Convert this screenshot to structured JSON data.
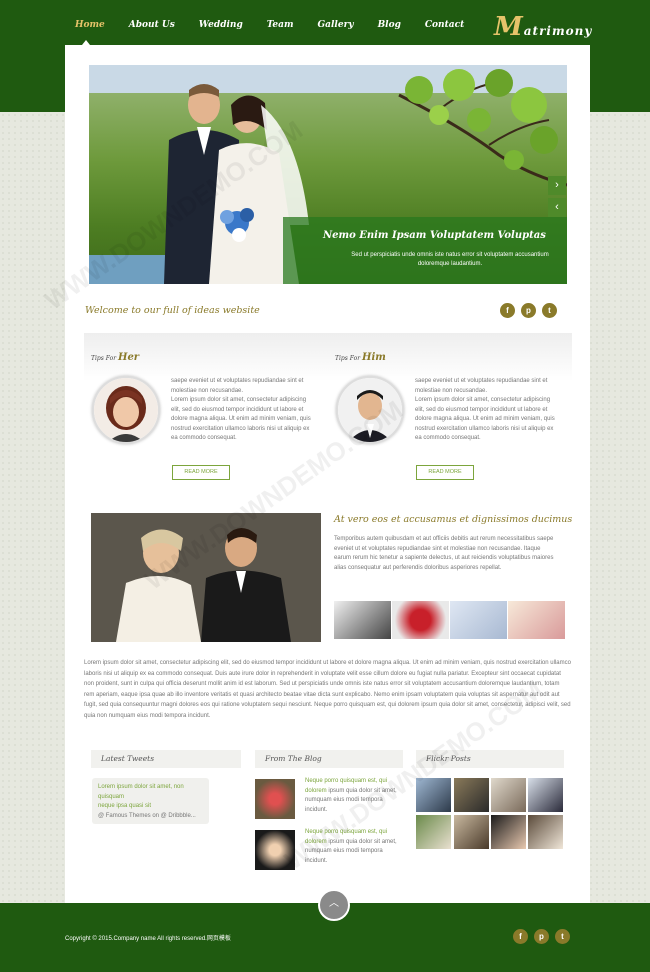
{
  "nav": {
    "items": [
      "Home",
      "About Us",
      "Wedding",
      "Team",
      "Gallery",
      "Blog",
      "Contact"
    ],
    "active": "Home"
  },
  "logo": {
    "first_letter": "M",
    "rest": "atrimony"
  },
  "slider": {
    "caption_title": "Nemo Enim Ipsam Voluptatem Voluptas",
    "caption_text": "Sed ut perspiciatis unde omnis iste natus error sit voluptatem accusantium doloremque laudantium.",
    "next_label": "›",
    "prev_label": "‹"
  },
  "welcome": {
    "text": "Welcome to our full of ideas website"
  },
  "social": {
    "facebook": "f",
    "pinterest": "p",
    "twitter": "t"
  },
  "tips": {
    "her": {
      "prefix": "Tips For",
      "name": "Her",
      "highlight": "saepe eveniet ut et voluptates repudiandae sint et molestiae non recusandae.",
      "body": "Lorem ipsum dolor sit amet, consectetur adipiscing elit, sed do eiusmod tempor incididunt ut labore et dolore magna aliqua. Ut enim ad minim veniam, quis nostrud exercitation ullamco laboris nisi ut aliquip ex ea commodo consequat.",
      "button": "READ MORE"
    },
    "him": {
      "prefix": "Tips For",
      "name": "Him",
      "highlight": "saepe eveniet ut et voluptates repudiandae sint et molestiae non recusandae.",
      "body": "Lorem ipsum dolor sit amet, consectetur adipiscing elit, sed do eiusmod tempor incididunt ut labore et dolore magna aliqua. Ut enim ad minim veniam, quis nostrud exercitation ullamco laboris nisi ut aliquip ex ea commodo consequat.",
      "button": "READ MORE"
    }
  },
  "feature": {
    "title": "At vero eos et accusamus et dignissimos ducimus",
    "text": "Temporibus autem quibusdam et aut officiis debitis aut rerum necessitatibus saepe eveniet ut et voluptates repudiandae sint et molestiae non recusandae. Itaque earum rerum hic tenetur a sapiente delectus, ut aut reiciendis voluptatibus maiores alias consequatur aut perferendis doloribus asperiores repellat."
  },
  "paragraph": "Lorem ipsum dolor sit amet, consectetur adipiscing elit, sed do eiusmod tempor incididunt ut labore et dolore magna aliqua. Ut enim ad minim veniam, quis nostrud exercitation ullamco laboris nisi ut aliquip ex ea commodo consequat. Duis aute irure dolor in reprehenderit in voluptate velit esse cillum dolore eu fugiat nulla pariatur. Excepteur sint occaecat cupidatat non proident, sunt in culpa qui officia deserunt mollit anim id est laborum. Sed ut perspiciatis unde omnis iste natus error sit voluptatem accusantium doloremque laudantium, totam rem aperiam, eaque ipsa quae ab illo inventore veritatis et quasi architecto beatae vitae dicta sunt explicabo. Nemo enim ipsam voluptatem quia voluptas sit aspernatur aut odit aut fugit, sed quia consequuntur magni dolores eos qui ratione voluptatem sequi nesciunt. Neque porro quisquam est, qui dolorem ipsum quia dolor sit amet, consectetur, adipisci velit, sed quia non numquam eius modi tempora incidunt.",
  "columns": {
    "tweets": {
      "title": "Latest Tweets",
      "line1": "Lorem ipsum dolor sit amet, ",
      "link": "non quisquam",
      "line2": "neque ipsa quasi sit",
      "handle": "@ Famous Themes on @ Dribbble..."
    },
    "blog": {
      "title": "From The Blog",
      "posts": [
        {
          "highlight": "Neque porro quisquam est, qui dolorem",
          "text": "ipsum quia dolor sit amet, numquam eius modi tempora incidunt."
        },
        {
          "highlight": "Neque porro quisquam est, qui dolorem",
          "text": "ipsum quia dolor sit amet, numquam eius modi tempora incidunt."
        }
      ]
    },
    "flickr": {
      "title": "Flickr Posts"
    }
  },
  "footer": {
    "copyright": "Copyright © 2015.Company name All rights reserved.网页模板"
  },
  "up_label": "︿",
  "watermark": "WWW.DOWNDEMO.COM",
  "colors": {
    "brand_green": "#1f5a10",
    "accent_gold": "#8a7a2a",
    "highlight_green": "#7ca53c"
  }
}
